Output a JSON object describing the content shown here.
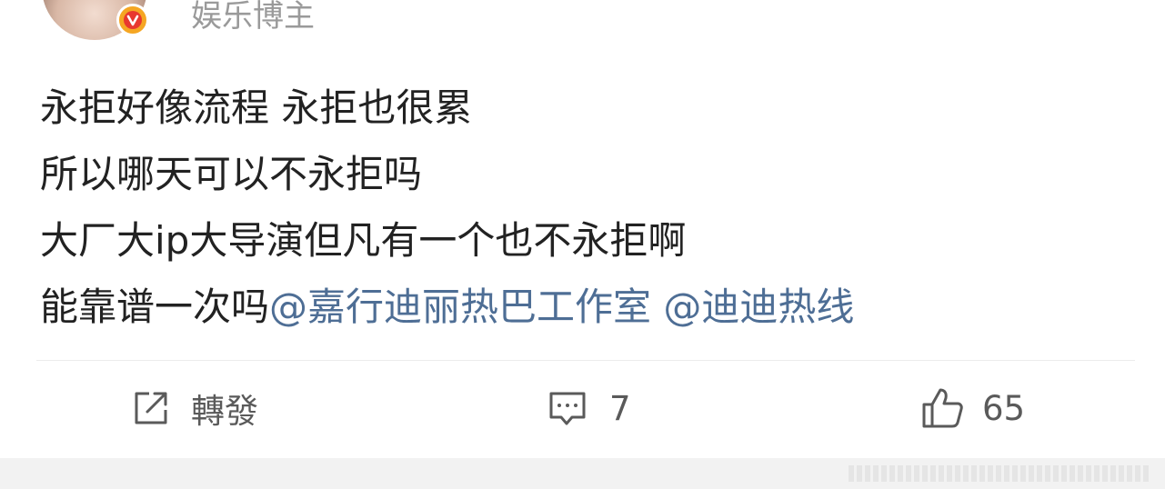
{
  "post": {
    "author_name": "娱乐博主",
    "verified_badge": "orange-v-badge",
    "lines": [
      "永拒好像流程 永拒也很累",
      "所以哪天可以不永拒吗",
      "大厂大ip大导演但凡有一个也不永拒啊"
    ],
    "last_line_text": "能靠谱一次吗",
    "mentions": [
      "@嘉行迪丽热巴工作室",
      "@迪迪热线"
    ]
  },
  "actions": {
    "repost_label": "轉發",
    "comment_count": "7",
    "like_count": "65"
  },
  "colors": {
    "text": "#222222",
    "mention": "#4e6e95",
    "muted": "#9a9a9a",
    "icon": "#5a5a5a",
    "badge": "#f5a623"
  }
}
